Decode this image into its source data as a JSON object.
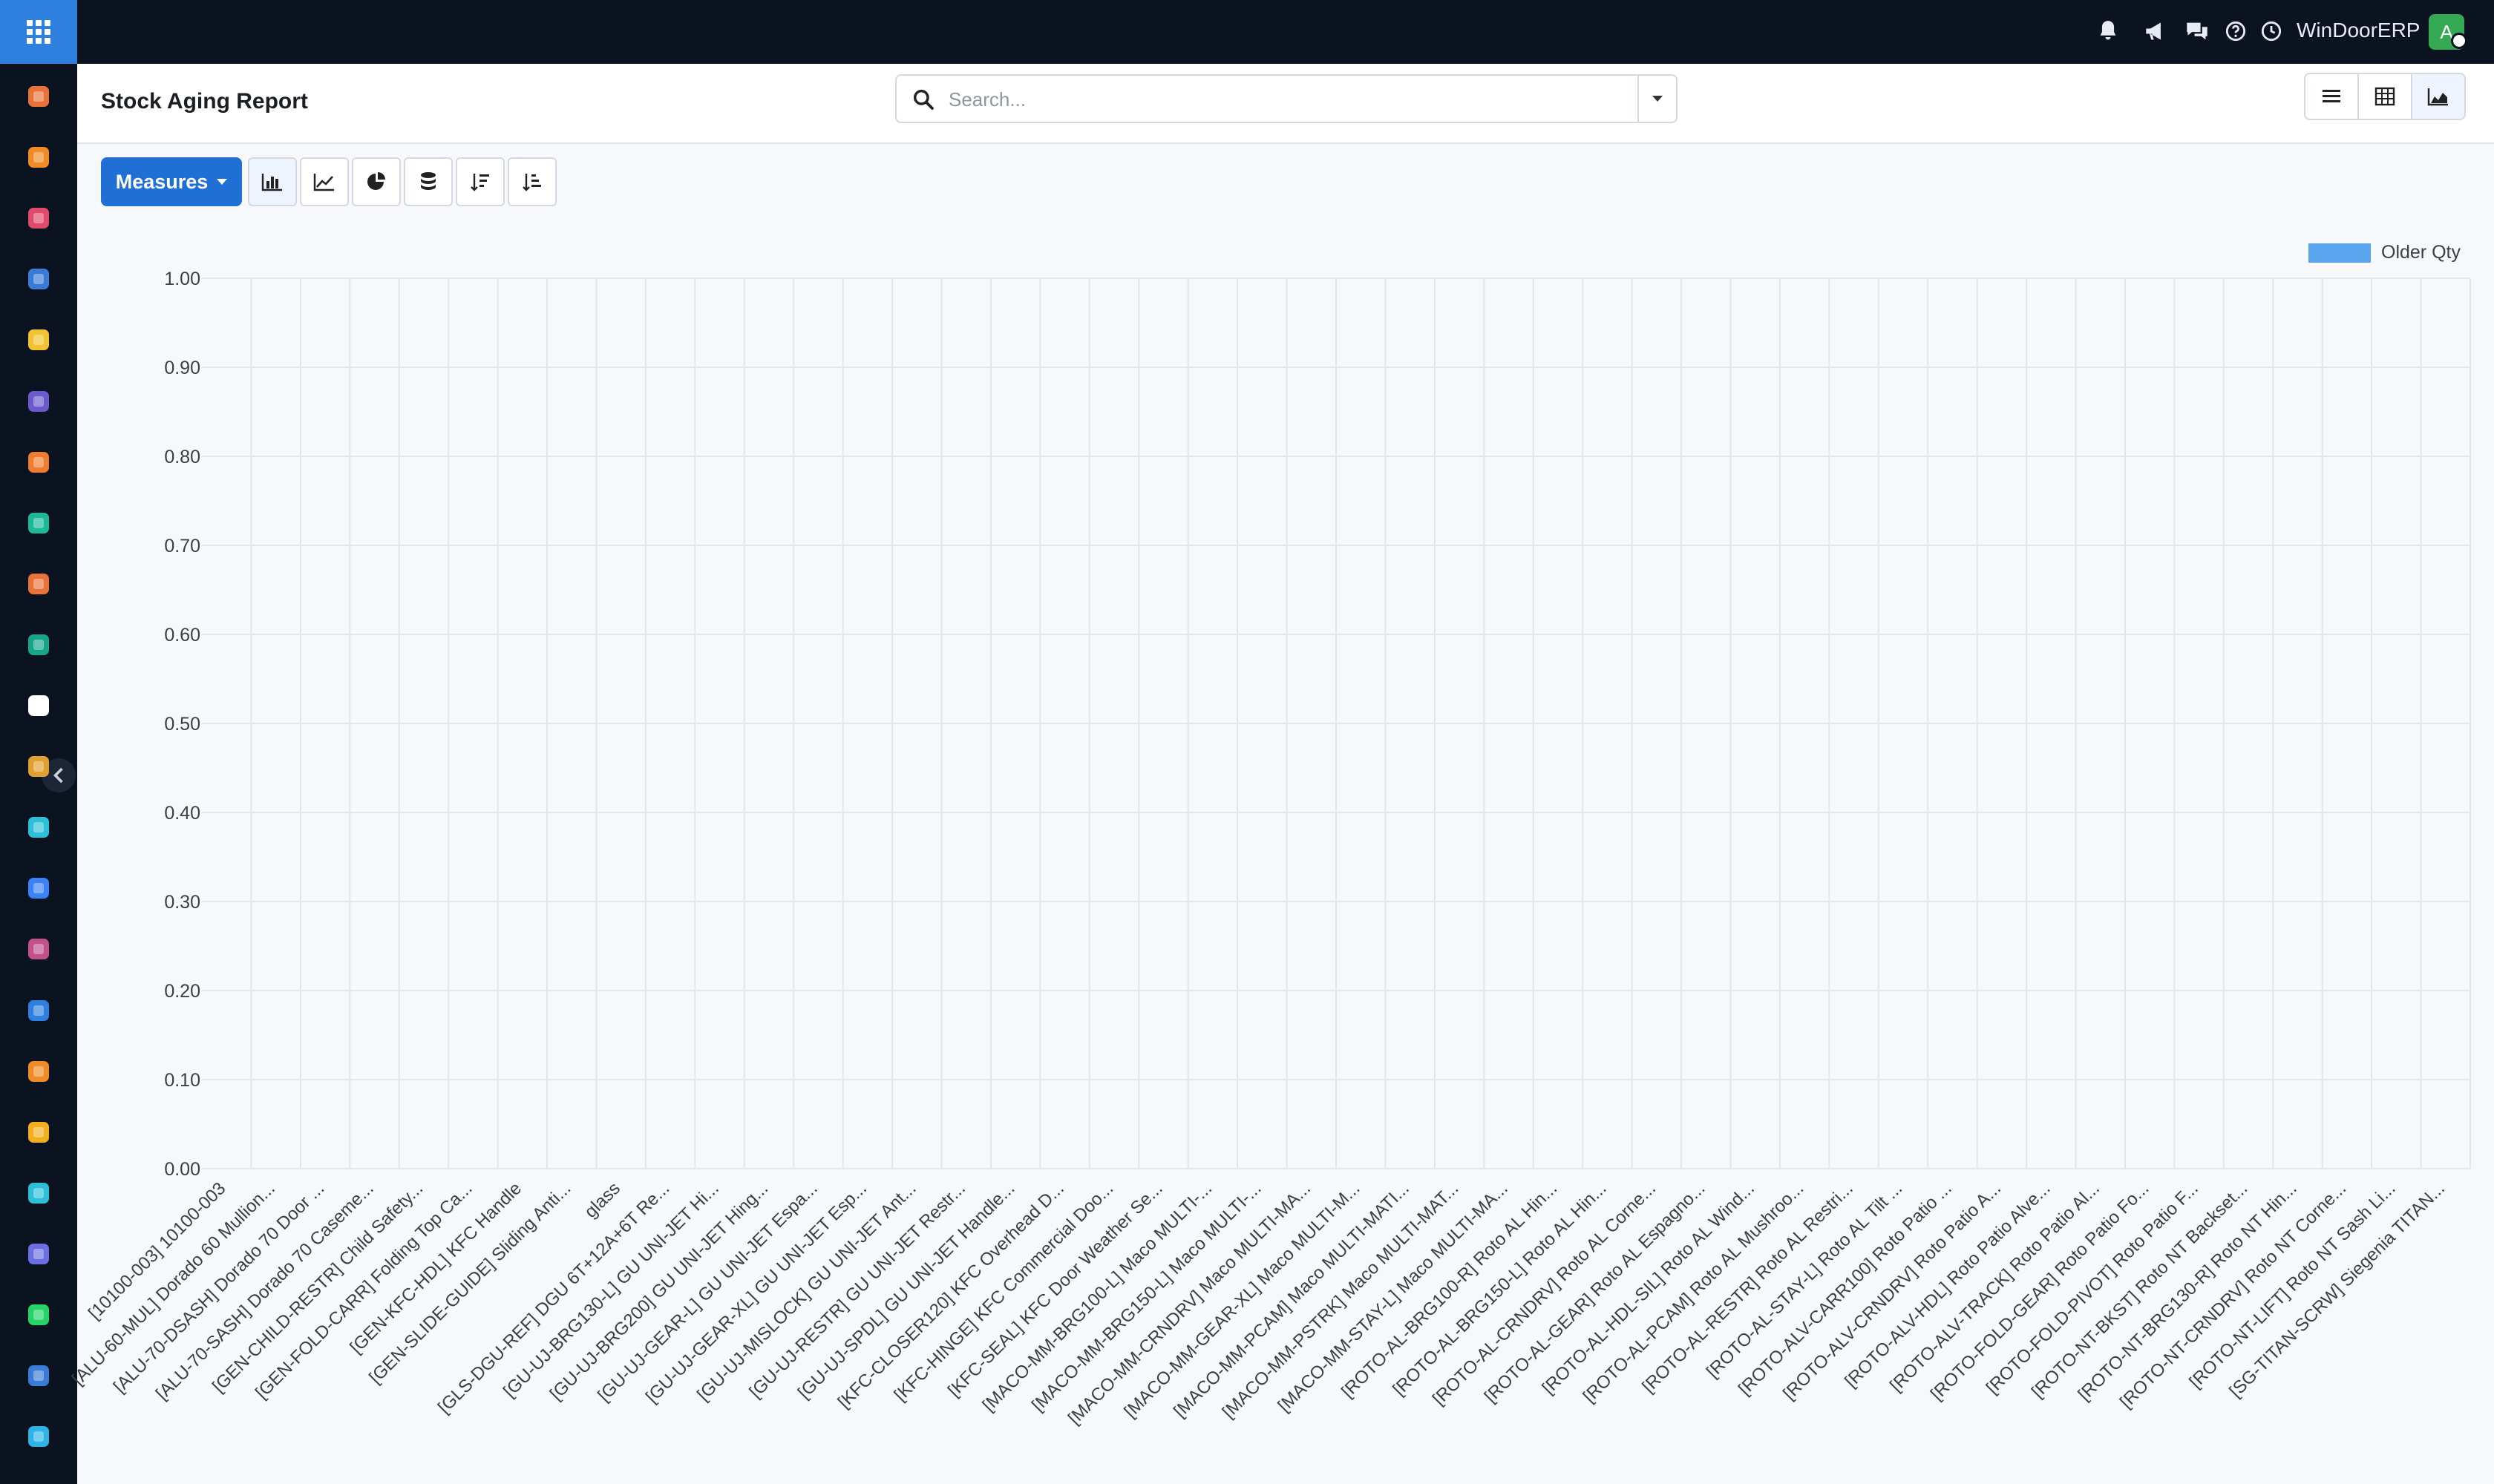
{
  "navbar": {
    "company": "WinDoorERP",
    "avatar_letter": "A",
    "icons": [
      "bell-icon",
      "megaphone-icon",
      "chat-icon",
      "help-icon",
      "clock-icon"
    ]
  },
  "sidebar": {
    "apps": [
      {
        "icon": "inventory-icon",
        "color": "#e8733a"
      },
      {
        "icon": "odoo-apps-icon",
        "color": "#f08a24"
      },
      {
        "icon": "pie-chart-icon",
        "color": "#e04a6b"
      },
      {
        "icon": "dashboard-gauge-icon",
        "color": "#3a7bd5"
      },
      {
        "icon": "paper-plane-icon",
        "color": "#f2c230"
      },
      {
        "icon": "mail-marketing-icon",
        "color": "#6a5acd"
      },
      {
        "icon": "chat-bubble-icon",
        "color": "#f07d2f"
      },
      {
        "icon": "funnel-icon",
        "color": "#1bb99a"
      },
      {
        "icon": "bar-chart-icon",
        "color": "#e8733a"
      },
      {
        "icon": "contacts-icon",
        "color": "#17a589"
      },
      {
        "icon": "box-icon",
        "color": "#ffffff"
      },
      {
        "icon": "pen-tool-icon",
        "color": "#e0a030"
      },
      {
        "icon": "check-icon",
        "color": "#2cc0d8"
      },
      {
        "icon": "book-icon",
        "color": "#3b82f6"
      },
      {
        "icon": "package-icon",
        "color": "#c2508a"
      },
      {
        "icon": "invoice-icon",
        "color": "#2f7fdf"
      },
      {
        "icon": "employees-icon",
        "color": "#f08a24"
      },
      {
        "icon": "calendar-icon",
        "color": "#f2b01e"
      },
      {
        "icon": "sign-icon",
        "color": "#2cc0d8"
      },
      {
        "icon": "widgets-icon",
        "color": "#6a6ee0"
      },
      {
        "icon": "whatsapp-icon",
        "color": "#25d366"
      },
      {
        "icon": "gauge-icon",
        "color": "#3a7bd5"
      },
      {
        "icon": "discuss-icon",
        "color": "#2fb3e6"
      }
    ]
  },
  "control_panel": {
    "title": "Stock Aging Report",
    "search_placeholder": "Search..."
  },
  "toolbar": {
    "measures_label": "Measures"
  },
  "colors": {
    "accent": "#1f6fd4",
    "series": "#59a5ee",
    "navbar": "#0b1220"
  },
  "chart_data": {
    "type": "bar",
    "ylim": [
      0,
      1
    ],
    "yticks": [
      "0.00",
      "0.10",
      "0.20",
      "0.30",
      "0.40",
      "0.50",
      "0.60",
      "0.70",
      "0.80",
      "0.90",
      "1.00"
    ],
    "grid": true,
    "legend_position": "top-right",
    "series": [
      {
        "name": "Older Qty",
        "values": [
          0,
          0,
          0,
          0,
          0,
          0,
          0,
          0,
          0,
          0,
          0,
          0,
          0,
          0,
          0,
          0,
          0,
          0,
          0,
          0,
          0,
          0,
          0,
          0,
          0,
          0,
          0,
          0,
          0,
          0,
          0,
          0,
          0,
          0,
          0,
          0,
          0,
          0,
          0,
          0,
          0,
          0,
          0,
          0,
          0,
          0,
          0
        ]
      }
    ],
    "categories": [
      "[10100-003] 10100-003",
      "[ALU-60-MUL] Dorado 60 Mullion...",
      "[ALU-70-DSASH] Dorado 70 Door ...",
      "[ALU-70-SASH] Dorado 70 Caseme...",
      "[GEN-CHILD-RESTR] Child Safety...",
      "[GEN-FOLD-CARR] Folding Top Ca...",
      "[GEN-KFC-HDL] KFC Handle",
      "[GEN-SLIDE-GUIDE] Sliding Anti...",
      "glass",
      "[GLS-DGU-REF] DGU 6T+12A+6T Re...",
      "[GU-UJ-BRG130-L] GU UNI-JET Hi...",
      "[GU-UJ-BRG200] GU UNI-JET Hing...",
      "[GU-UJ-GEAR-L] GU UNI-JET Espa...",
      "[GU-UJ-GEAR-XL] GU UNI-JET Esp...",
      "[GU-UJ-MISLOCK] GU UNI-JET Ant...",
      "[GU-UJ-RESTR] GU UNI-JET Restr...",
      "[GU-UJ-SPDL] GU UNI-JET Handle...",
      "[KFC-CLOSER120] KFC Overhead D...",
      "[KFC-HINGE] KFC Commercial Doo...",
      "[KFC-SEAL] KFC Door Weather Se...",
      "[MACO-MM-BRG100-L] Maco MULTI-...",
      "[MACO-MM-BRG150-L] Maco MULTI-...",
      "[MACO-MM-CRNDRV] Maco MULTI-MA...",
      "[MACO-MM-GEAR-XL] Maco MULTI-M...",
      "[MACO-MM-PCAM] Maco MULTI-MATI...",
      "[MACO-MM-PSTRK] Maco MULTI-MAT...",
      "[MACO-MM-STAY-L] Maco MULTI-MA...",
      "[ROTO-AL-BRG100-R] Roto AL Hin...",
      "[ROTO-AL-BRG150-L] Roto AL Hin...",
      "[ROTO-AL-CRNDRV] Roto AL Corne...",
      "[ROTO-AL-GEAR] Roto AL Espagno...",
      "[ROTO-AL-HDL-SIL] Roto AL Wind...",
      "[ROTO-AL-PCAM] Roto AL Mushroo...",
      "[ROTO-AL-RESTR] Roto AL Restri...",
      "[ROTO-AL-STAY-L] Roto AL Tilt ...",
      "[ROTO-ALV-CARR100] Roto Patio ...",
      "[ROTO-ALV-CRNDRV] Roto Patio A...",
      "[ROTO-ALV-HDL] Roto Patio Alve...",
      "[ROTO-ALV-TRACK] Roto Patio Al...",
      "[ROTO-FOLD-GEAR] Roto Patio Fo...",
      "[ROTO-FOLD-PIVOT] Roto Patio F...",
      "[ROTO-NT-BKST] Roto NT Backset...",
      "[ROTO-NT-BRG130-R] Roto NT Hin...",
      "[ROTO-NT-CRNDRV] Roto NT Corne...",
      "[ROTO-NT-LIFT] Roto NT Sash Li...",
      "[SG-TITAN-SCRW] Siegenia TITAN..."
    ]
  }
}
